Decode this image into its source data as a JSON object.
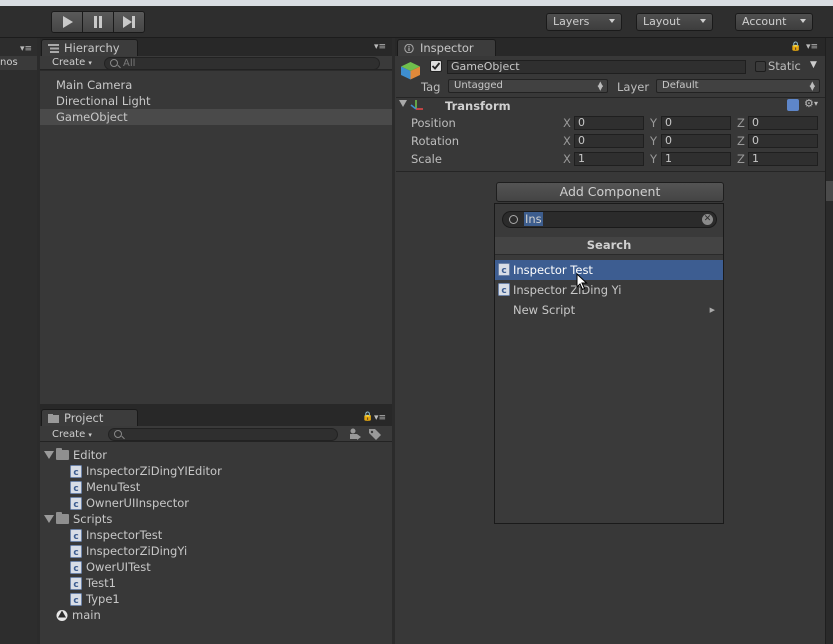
{
  "toolbar": {
    "play_icon": "play-icon",
    "pause_icon": "pause-icon",
    "step_icon": "step-icon",
    "layers_label": "Layers",
    "layout_label": "Layout",
    "account_label": "Account"
  },
  "left_stub": {
    "label": "nos"
  },
  "hierarchy": {
    "tab_label": "Hierarchy",
    "create_label": "Create",
    "search_placeholder": "All",
    "items": [
      {
        "label": "Main Camera"
      },
      {
        "label": "Directional Light"
      },
      {
        "label": "GameObject",
        "selected": true
      }
    ]
  },
  "project": {
    "tab_label": "Project",
    "create_label": "Create",
    "search_placeholder": "",
    "tree": [
      {
        "label": "Editor",
        "type": "folder"
      },
      {
        "label": "InspectorZiDingYIEditor",
        "type": "script"
      },
      {
        "label": "MenuTest",
        "type": "script"
      },
      {
        "label": "OwnerUIInspector",
        "type": "script"
      },
      {
        "label": "Scripts",
        "type": "folder"
      },
      {
        "label": "InspectorTest",
        "type": "script"
      },
      {
        "label": "InspectorZiDingYi",
        "type": "script"
      },
      {
        "label": "OwerUITest",
        "type": "script"
      },
      {
        "label": "Test1",
        "type": "script"
      },
      {
        "label": "Type1",
        "type": "script"
      },
      {
        "label": "main",
        "type": "scene"
      }
    ]
  },
  "inspector": {
    "tab_label": "Inspector",
    "object_name": "GameObject",
    "active_checked": true,
    "static_label": "Static",
    "tag_label": "Tag",
    "tag_value": "Untagged",
    "layer_label": "Layer",
    "layer_value": "Default",
    "transform": {
      "title": "Transform",
      "rows": [
        {
          "label": "Position",
          "x": "0",
          "y": "0",
          "z": "0"
        },
        {
          "label": "Rotation",
          "x": "0",
          "y": "0",
          "z": "0"
        },
        {
          "label": "Scale",
          "x": "1",
          "y": "1",
          "z": "1"
        }
      ]
    },
    "axis": {
      "x": "X",
      "y": "Y",
      "z": "Z"
    }
  },
  "add_component": {
    "button_label": "Add Component",
    "search_value": "Ins",
    "header": "Search",
    "items": [
      {
        "label": "Inspector Test",
        "selected": true
      },
      {
        "label": "Inspector ZiDing Yi"
      },
      {
        "label": "New Script",
        "submenu": true
      }
    ]
  },
  "colors": {
    "background": "#2b2b2b",
    "panel": "#383838",
    "selection_blue": "#3d5d91",
    "text": "#c8c8c8"
  }
}
